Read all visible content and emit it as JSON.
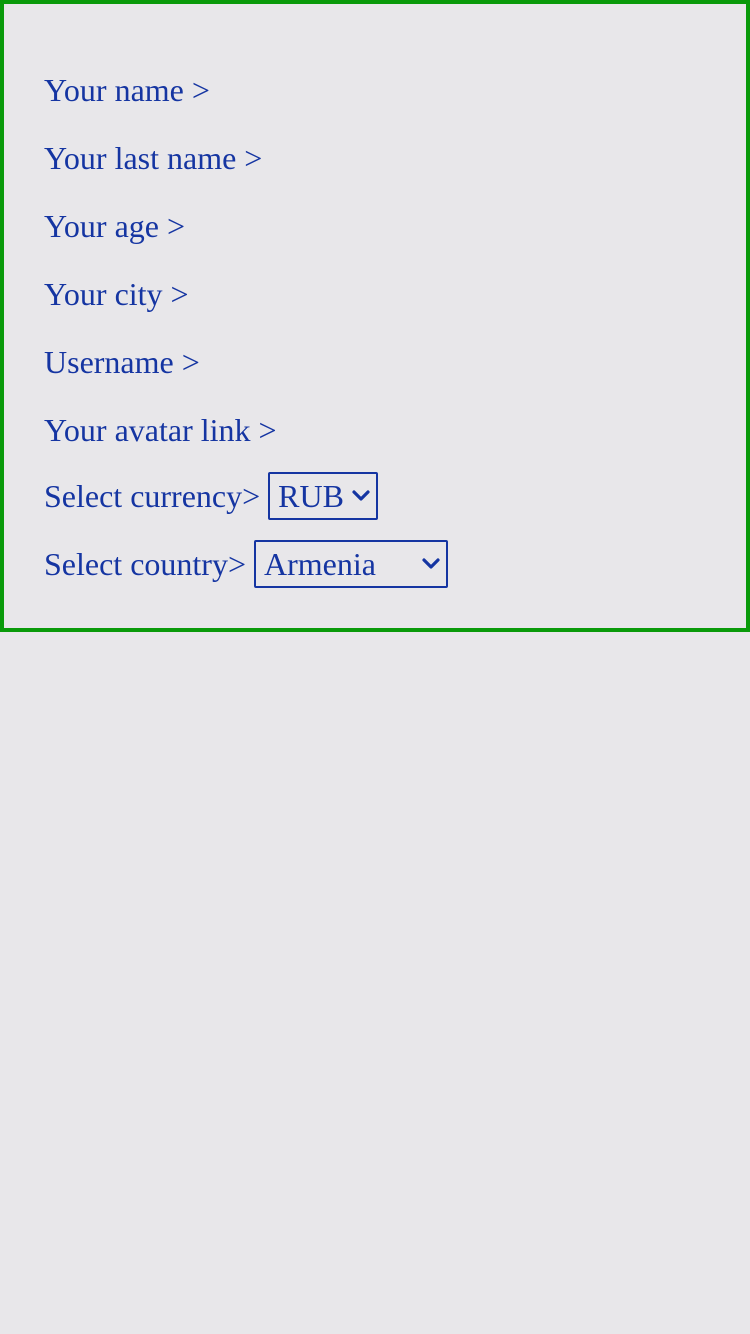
{
  "form": {
    "fields": [
      {
        "label": "Your name >"
      },
      {
        "label": "Your last name >"
      },
      {
        "label": "Your age >"
      },
      {
        "label": "Your city >"
      },
      {
        "label": "Username >"
      },
      {
        "label": "Your avatar link >"
      }
    ],
    "currency": {
      "label": "Select currency>",
      "selected": "RUB"
    },
    "country": {
      "label": "Select country>",
      "selected": "Armenia"
    }
  },
  "colors": {
    "border": "#0a9a0a",
    "text": "#1535a2",
    "background": "#e8e7ea"
  },
  "icons": {
    "dropdown": "chevron-down-icon"
  }
}
